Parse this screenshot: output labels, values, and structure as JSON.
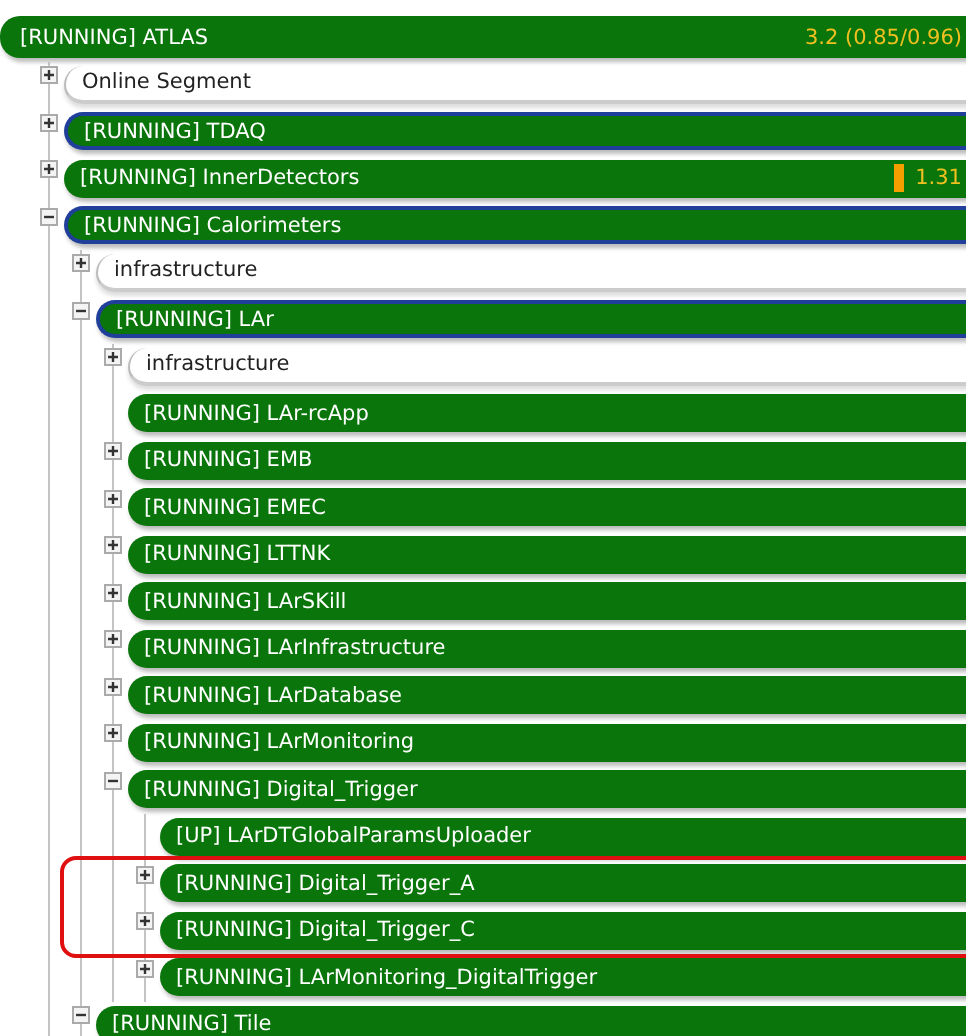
{
  "tree": {
    "label": "[RUNNING] ATLAS",
    "kind": "status",
    "value": "3.2 (0.85/0.96)",
    "children": [
      {
        "label": "Online Segment",
        "kind": "segment",
        "expanded": false
      },
      {
        "label": "[RUNNING] TDAQ",
        "kind": "status",
        "outlined": true,
        "expanded": false
      },
      {
        "label": "[RUNNING] InnerDetectors",
        "kind": "status",
        "outlined": false,
        "expanded": false,
        "warning": true,
        "value": "1.31"
      },
      {
        "label": "[RUNNING] Calorimeters",
        "kind": "status",
        "outlined": true,
        "expanded": true,
        "children": [
          {
            "label": "infrastructure",
            "kind": "segment",
            "expanded": false
          },
          {
            "label": "[RUNNING] LAr",
            "kind": "status",
            "outlined": true,
            "expanded": true,
            "children": [
              {
                "label": "infrastructure",
                "kind": "segment",
                "expanded": false
              },
              {
                "label": "[RUNNING] LAr-rcApp",
                "kind": "status"
              },
              {
                "label": "[RUNNING] EMB",
                "kind": "status",
                "expanded": false
              },
              {
                "label": "[RUNNING] EMEC",
                "kind": "status",
                "expanded": false
              },
              {
                "label": "[RUNNING] LTTNK",
                "kind": "status",
                "expanded": false
              },
              {
                "label": "[RUNNING] LArSKill",
                "kind": "status",
                "expanded": false
              },
              {
                "label": "[RUNNING] LArInfrastructure",
                "kind": "status",
                "expanded": false
              },
              {
                "label": "[RUNNING] LArDatabase",
                "kind": "status",
                "expanded": false
              },
              {
                "label": "[RUNNING] LArMonitoring",
                "kind": "status",
                "expanded": false
              },
              {
                "label": "[RUNNING] Digital_Trigger",
                "kind": "status",
                "expanded": true,
                "children": [
                  {
                    "label": "[UP] LArDTGlobalParamsUploader",
                    "kind": "status"
                  },
                  {
                    "label": "[RUNNING] Digital_Trigger_A",
                    "kind": "status",
                    "expanded": false,
                    "highlighted": true
                  },
                  {
                    "label": "[RUNNING] Digital_Trigger_C",
                    "kind": "status",
                    "expanded": false,
                    "highlighted": true
                  },
                  {
                    "label": "[RUNNING] LArMonitoring_DigitalTrigger",
                    "kind": "status",
                    "expanded": false
                  }
                ]
              }
            ]
          },
          {
            "label": "[RUNNING] Tile",
            "kind": "status",
            "outlined": false,
            "expanded": true
          }
        ]
      }
    ]
  }
}
